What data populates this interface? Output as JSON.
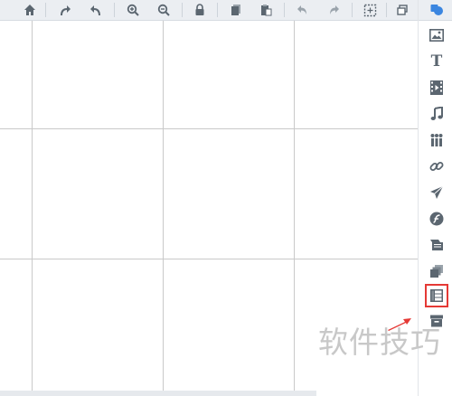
{
  "toolbar": {
    "buttons": [
      {
        "id": "home",
        "icon": "home-icon"
      },
      {
        "id": "redo-curve",
        "icon": "curved-arrow-up-icon"
      },
      {
        "id": "undo-curve",
        "icon": "curved-arrow-back-icon"
      },
      {
        "id": "zoom-in",
        "icon": "zoom-in-icon"
      },
      {
        "id": "zoom-out",
        "icon": "zoom-out-icon"
      },
      {
        "id": "lock",
        "icon": "lock-icon"
      },
      {
        "id": "copy",
        "icon": "copy-icon"
      },
      {
        "id": "paste",
        "icon": "paste-icon"
      },
      {
        "id": "undo",
        "icon": "undo-icon"
      },
      {
        "id": "redo",
        "icon": "redo-icon"
      },
      {
        "id": "select",
        "icon": "marquee-select-icon"
      },
      {
        "id": "window",
        "icon": "window-restore-icon"
      }
    ]
  },
  "sidebar": {
    "items": [
      {
        "id": "shapes",
        "icon": "shapes-icon"
      },
      {
        "id": "image",
        "icon": "image-icon"
      },
      {
        "id": "text",
        "icon": "text-icon",
        "glyph": "T"
      },
      {
        "id": "video",
        "icon": "video-icon"
      },
      {
        "id": "music",
        "icon": "music-icon"
      },
      {
        "id": "people",
        "icon": "people-icon"
      },
      {
        "id": "link",
        "icon": "link-icon"
      },
      {
        "id": "plane",
        "icon": "plane-icon"
      },
      {
        "id": "flash",
        "icon": "flash-icon"
      },
      {
        "id": "media-stack",
        "icon": "media-stack-icon"
      },
      {
        "id": "layers",
        "icon": "layers-icon"
      },
      {
        "id": "layout",
        "icon": "layout-icon",
        "active": true
      },
      {
        "id": "archive",
        "icon": "archive-icon"
      }
    ]
  },
  "colors": {
    "icon": "#5b6670",
    "accent": "#3b86e0",
    "highlight": "#e53935",
    "grid": "#c9c9c9",
    "toolbar_bg": "#ebeef2"
  },
  "watermark": {
    "text": "软件技巧"
  }
}
